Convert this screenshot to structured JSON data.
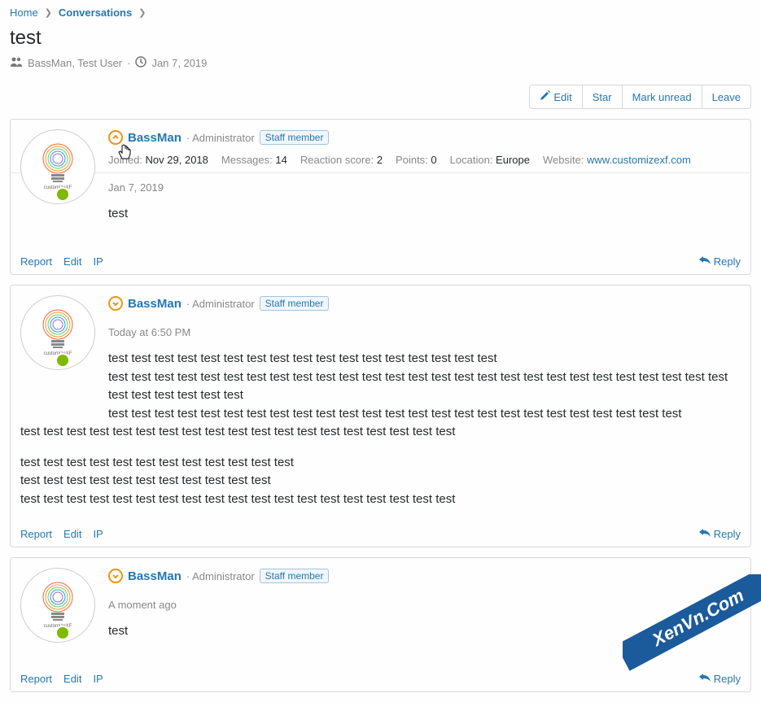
{
  "breadcrumb": {
    "home": "Home",
    "conversations": "Conversations"
  },
  "page_title": "test",
  "participants": "BassMan, Test User",
  "start_date": "Jan 7, 2019",
  "actions": {
    "edit": "Edit",
    "star": "Star",
    "mark_unread": "Mark unread",
    "leave": "Leave"
  },
  "badge_staff": "Staff member",
  "role_admin": "Administrator",
  "labels": {
    "joined": "Joined:",
    "messages": "Messages:",
    "reaction_score": "Reaction score:",
    "points": "Points:",
    "location": "Location:",
    "website": "Website:"
  },
  "user": {
    "name": "BassMan",
    "joined": "Nov 29, 2018",
    "messages": "14",
    "reaction_score": "2",
    "points": "0",
    "location": "Europe",
    "website": "www.customizexf.com"
  },
  "messages": [
    {
      "date": "Jan 7, 2019",
      "body": "test",
      "expanded": true
    },
    {
      "date": "Today at 6:50 PM",
      "body_html": "<p>test test test test test test test test test test test test test test test test test<br>test test test test test test test test test test test test test test test test test test test test test test test test test test test test test test test test test<br>test test test test test test test test test test test test test test test test test test test test test test test test test<br>test test test test test test test test test test test test test test test test test test test</p><p>test test test test test test test test test test test test<br>test test test test test test test test test test test<br>test test test test test test test test test test test test test test test test test test test</p>",
      "expanded": false
    },
    {
      "date": "A moment ago",
      "body": "test",
      "expanded": false
    }
  ],
  "footer": {
    "report": "Report",
    "edit": "Edit",
    "ip": "IP",
    "reply": "Reply"
  },
  "watermark": "XenVn.Com"
}
